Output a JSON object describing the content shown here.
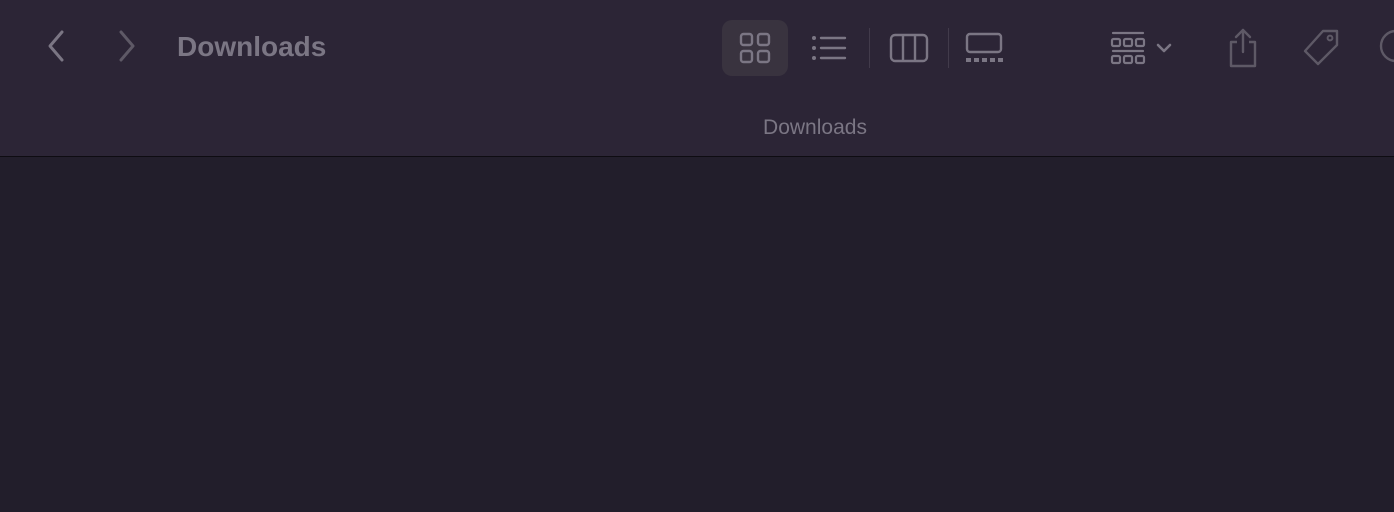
{
  "window": {
    "title": "Downloads",
    "path_label": "Downloads"
  },
  "toolbar": {
    "back_icon": "chevron-left-icon",
    "forward_icon": "chevron-right-icon",
    "view_modes": [
      {
        "name": "icons",
        "icon": "icon-grid-icon",
        "selected": true
      },
      {
        "name": "list",
        "icon": "list-icon",
        "selected": false
      },
      {
        "name": "columns",
        "icon": "columns-icon",
        "selected": false
      },
      {
        "name": "gallery",
        "icon": "gallery-icon",
        "selected": false
      }
    ],
    "group_icon": "group-grid-icon",
    "share_icon": "share-icon",
    "tag_icon": "tag-icon"
  },
  "colors": {
    "toolbar_bg": "#2c2536",
    "content_bg": "#221e2b",
    "icon": "#7b7684",
    "selected_bg": "#39333f"
  }
}
